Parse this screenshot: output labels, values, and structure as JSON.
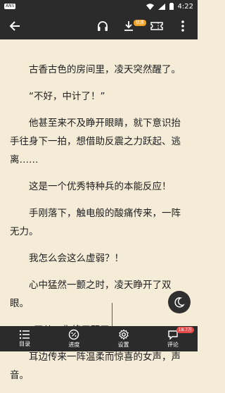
{
  "status": {
    "app_chip": "ANS",
    "time": "4:22"
  },
  "toolbar": {
    "download_badge": "优惠"
  },
  "reader": {
    "paragraphs": [
      "古香古色的房间里，凌天突然醒了。",
      "“不好，中计了！”",
      "他甚至来不及睁开眼睛，就下意识抬手往身下一拍，想借助反震之力跃起、逃离……",
      "这是一个优秀特种兵的本能反应！",
      "手刚落下，触电般的酸痛传来，一阵无力。",
      "我怎么会这么虚弱？！",
      "心中猛然一颤之时，凌天睁开了双眼。",
      "“天儿，你终于醒了。”",
      "耳边传来一阵温柔而惊喜的女声，声音。"
    ]
  },
  "bottom_nav": {
    "items": [
      {
        "label": "目录"
      },
      {
        "label": "进度"
      },
      {
        "label": "设置"
      },
      {
        "label": "评论",
        "badge": "18.7万"
      }
    ]
  }
}
